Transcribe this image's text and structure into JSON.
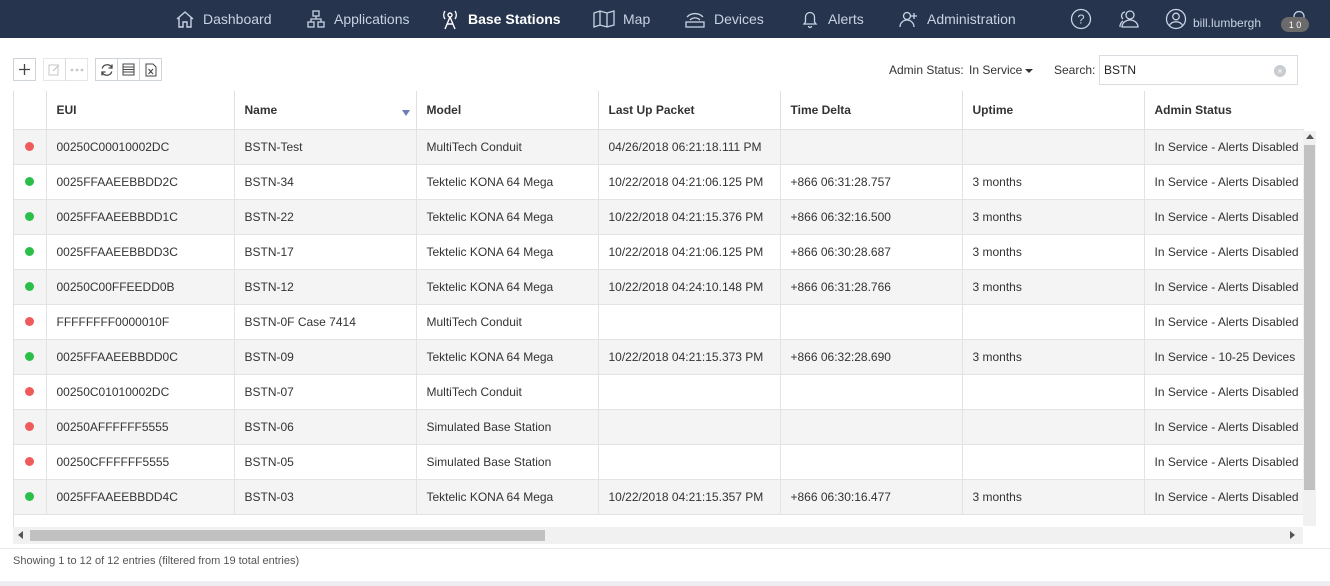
{
  "nav": {
    "items": [
      {
        "label": "Dashboard",
        "icon": "home-icon"
      },
      {
        "label": "Applications",
        "icon": "applications-icon"
      },
      {
        "label": "Base Stations",
        "icon": "base-station-icon"
      },
      {
        "label": "Map",
        "icon": "map-icon"
      },
      {
        "label": "Devices",
        "icon": "devices-icon"
      },
      {
        "label": "Alerts",
        "icon": "bell-icon"
      },
      {
        "label": "Administration",
        "icon": "add-user-icon"
      }
    ],
    "active": "Base Stations",
    "user": "bill.lumbergh",
    "notification_count": "1 0"
  },
  "toolbar": {
    "buttons": [
      "add-icon",
      "edit-icon",
      "more-icon",
      "refresh-icon",
      "columns-icon",
      "export-excel-icon"
    ]
  },
  "filters": {
    "admin_status_label": "Admin Status:",
    "admin_status_value": "In Service",
    "search_label": "Search:",
    "search_value": "BSTN"
  },
  "table": {
    "columns": [
      "",
      "EUI",
      "Name",
      "Model",
      "Last Up Packet",
      "Time Delta",
      "Uptime",
      "Admin Status"
    ],
    "sorted_column": "Name",
    "rows": [
      {
        "status": "red",
        "eui": "00250C00010002DC",
        "name": "BSTN-Test",
        "model": "MultiTech Conduit",
        "last_up": "04/26/2018 06:21:18.111 PM",
        "delta": "",
        "uptime": "",
        "admin": "In Service - Alerts Disabled"
      },
      {
        "status": "green",
        "eui": "0025FFAAEEBBDD2C",
        "name": "BSTN-34",
        "model": "Tektelic KONA 64 Mega",
        "last_up": "10/22/2018 04:21:06.125 PM",
        "delta": "+866 06:31:28.757",
        "uptime": "3 months",
        "admin": "In Service - Alerts Disabled"
      },
      {
        "status": "green",
        "eui": "0025FFAAEEBBDD1C",
        "name": "BSTN-22",
        "model": "Tektelic KONA 64 Mega",
        "last_up": "10/22/2018 04:21:15.376 PM",
        "delta": "+866 06:32:16.500",
        "uptime": "3 months",
        "admin": "In Service - Alerts Disabled"
      },
      {
        "status": "green",
        "eui": "0025FFAAEEBBDD3C",
        "name": "BSTN-17",
        "model": "Tektelic KONA 64 Mega",
        "last_up": "10/22/2018 04:21:06.125 PM",
        "delta": "+866 06:30:28.687",
        "uptime": "3 months",
        "admin": "In Service - Alerts Disabled"
      },
      {
        "status": "green",
        "eui": "00250C00FFEEDD0B",
        "name": "BSTN-12",
        "model": "Tektelic KONA 64 Mega",
        "last_up": "10/22/2018 04:24:10.148 PM",
        "delta": "+866 06:31:28.766",
        "uptime": "3 months",
        "admin": "In Service - Alerts Disabled"
      },
      {
        "status": "red",
        "eui": "FFFFFFFF0000010F",
        "name": "BSTN-0F Case 7414",
        "model": "MultiTech Conduit",
        "last_up": "",
        "delta": "",
        "uptime": "",
        "admin": "In Service - Alerts Disabled"
      },
      {
        "status": "green",
        "eui": "0025FFAAEEBBDD0C",
        "name": "BSTN-09",
        "model": "Tektelic KONA 64 Mega",
        "last_up": "10/22/2018 04:21:15.373 PM",
        "delta": "+866 06:32:28.690",
        "uptime": "3 months",
        "admin": "In Service - 10-25 Devices"
      },
      {
        "status": "red",
        "eui": "00250C01010002DC",
        "name": "BSTN-07",
        "model": "MultiTech Conduit",
        "last_up": "",
        "delta": "",
        "uptime": "",
        "admin": "In Service - Alerts Disabled"
      },
      {
        "status": "red",
        "eui": "00250AFFFFFF5555",
        "name": "BSTN-06",
        "model": "Simulated Base Station",
        "last_up": "",
        "delta": "",
        "uptime": "",
        "admin": "In Service - Alerts Disabled"
      },
      {
        "status": "red",
        "eui": "00250CFFFFFF5555",
        "name": "BSTN-05",
        "model": "Simulated Base Station",
        "last_up": "",
        "delta": "",
        "uptime": "",
        "admin": "In Service - Alerts Disabled"
      },
      {
        "status": "green",
        "eui": "0025FFAAEEBBDD4C",
        "name": "BSTN-03",
        "model": "Tektelic KONA 64 Mega",
        "last_up": "10/22/2018 04:21:15.357 PM",
        "delta": "+866 06:30:16.477",
        "uptime": "3 months",
        "admin": "In Service - Alerts Disabled"
      }
    ]
  },
  "status_colors": {
    "red": "#f05a5a",
    "green": "#2bbf4a",
    "nav_bg": "#26344d"
  },
  "footer": {
    "info": "Showing 1 to 12 of 12 entries (filtered from 19 total entries)"
  }
}
